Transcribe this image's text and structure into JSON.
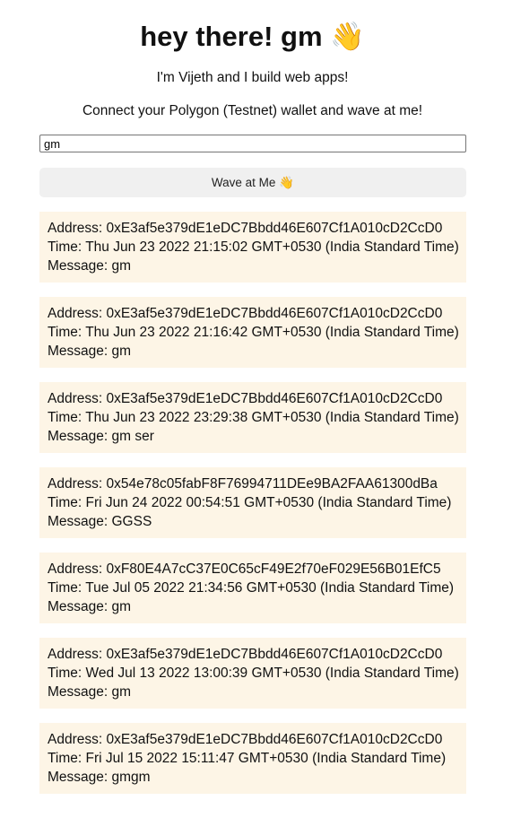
{
  "header": {
    "title": "hey there! gm",
    "title_emoji": "👋",
    "subtitle": "I'm Vijeth and I build web apps!",
    "instruction": "Connect your Polygon (Testnet) wallet and wave at me!"
  },
  "form": {
    "message_value": "gm",
    "button_label": "Wave at Me",
    "button_emoji": "👋"
  },
  "waves": [
    {
      "address": "Address: 0xE3af5e379dE1eDC7Bbdd46E607Cf1A010cD2CcD0",
      "time": "Time: Thu Jun 23 2022 21:15:02 GMT+0530 (India Standard Time)",
      "message": "Message: gm"
    },
    {
      "address": "Address: 0xE3af5e379dE1eDC7Bbdd46E607Cf1A010cD2CcD0",
      "time": "Time: Thu Jun 23 2022 21:16:42 GMT+0530 (India Standard Time)",
      "message": "Message: gm"
    },
    {
      "address": "Address: 0xE3af5e379dE1eDC7Bbdd46E607Cf1A010cD2CcD0",
      "time": "Time: Thu Jun 23 2022 23:29:38 GMT+0530 (India Standard Time)",
      "message": "Message: gm ser"
    },
    {
      "address": "Address: 0x54e78c05fabF8F76994711DEe9BA2FAA61300dBa",
      "time": "Time: Fri Jun 24 2022 00:54:51 GMT+0530 (India Standard Time)",
      "message": "Message: GGSS"
    },
    {
      "address": "Address: 0xF80E4A7cC37E0C65cF49E2f70eF029E56B01EfC5",
      "time": "Time: Tue Jul 05 2022 21:34:56 GMT+0530 (India Standard Time)",
      "message": "Message: gm"
    },
    {
      "address": "Address: 0xE3af5e379dE1eDC7Bbdd46E607Cf1A010cD2CcD0",
      "time": "Time: Wed Jul 13 2022 13:00:39 GMT+0530 (India Standard Time)",
      "message": "Message: gm"
    },
    {
      "address": "Address: 0xE3af5e379dE1eDC7Bbdd46E607Cf1A010cD2CcD0",
      "time": "Time: Fri Jul 15 2022 15:11:47 GMT+0530 (India Standard Time)",
      "message": "Message: gmgm"
    }
  ],
  "colors": {
    "card_background": "#fdf5e6",
    "button_background": "#f0f0f0",
    "text": "#111111"
  },
  "icons": {
    "title_icon": "waving-hand-icon",
    "button_icon": "waving-hand-icon"
  }
}
